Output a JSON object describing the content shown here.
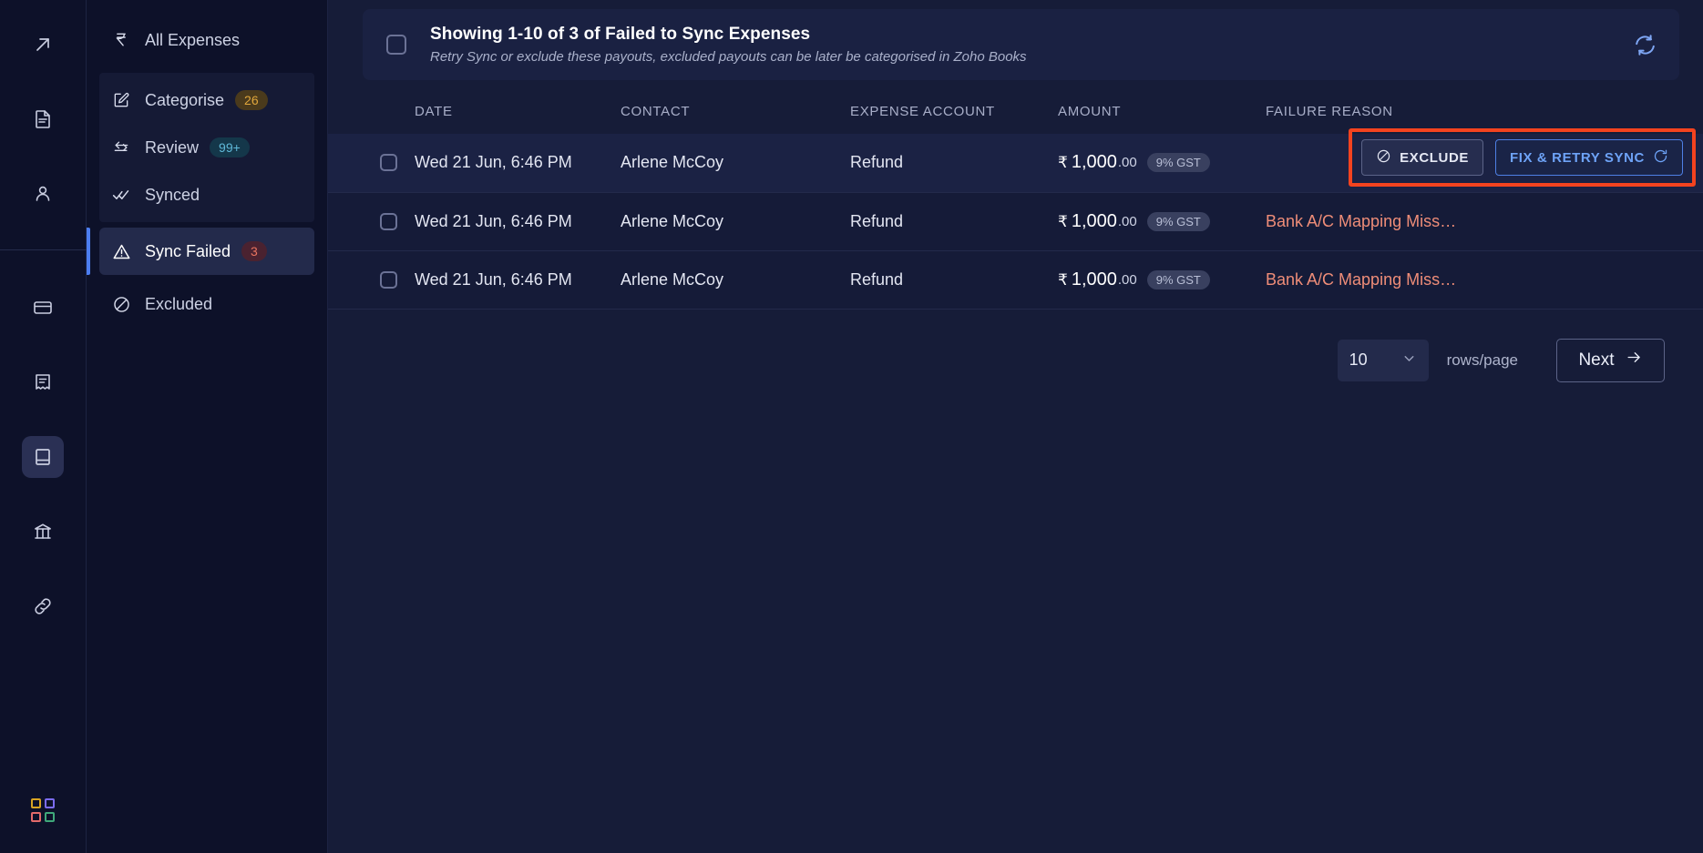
{
  "rail": {
    "icons": [
      {
        "name": "arrow-up-right-icon",
        "active": false
      },
      {
        "name": "document-icon",
        "active": false
      },
      {
        "name": "person-icon",
        "active": false
      },
      {
        "name": "card-icon",
        "active": false
      },
      {
        "name": "receipt-icon",
        "active": false
      },
      {
        "name": "book-icon",
        "active": true
      },
      {
        "name": "bank-icon",
        "active": false
      },
      {
        "name": "link-icon",
        "active": false
      }
    ],
    "logo_name": "grid-logo",
    "logo_colors": [
      "#d8a423",
      "#7b6cf0",
      "#e36a6a",
      "#3fa87a"
    ]
  },
  "sidebar": {
    "all_expenses": {
      "label": "All Expenses",
      "icon": "rupee-icon"
    },
    "group": [
      {
        "label": "Categorise",
        "icon": "edit-square-icon",
        "badge": "26",
        "badge_style": "amber"
      },
      {
        "label": "Review",
        "icon": "arrows-swap-icon",
        "badge": "99+",
        "badge_style": "teal"
      },
      {
        "label": "Synced",
        "icon": "double-check-icon",
        "badge": "",
        "badge_style": ""
      }
    ],
    "sync_failed": {
      "label": "Sync Failed",
      "icon": "warning-triangle-icon",
      "badge": "3",
      "badge_style": "red"
    },
    "excluded": {
      "label": "Excluded",
      "icon": "ban-icon"
    }
  },
  "header": {
    "title": "Showing 1-10 of 3 of Failed to Sync Expenses",
    "subtitle": "Retry Sync or exclude these payouts, excluded payouts can be later be categorised in Zoho Books",
    "refresh_icon": "refresh-icon"
  },
  "table": {
    "columns": [
      "DATE",
      "CONTACT",
      "EXPENSE ACCOUNT",
      "AMOUNT",
      "FAILURE REASON"
    ],
    "rows": [
      {
        "date": "Wed 21 Jun, 6:46 PM",
        "contact": "Arlene McCoy",
        "account": "Refund",
        "currency": "₹",
        "amount": "1,000",
        "decimals": ".00",
        "gst": "9% GST",
        "failure": "",
        "hovered": true
      },
      {
        "date": "Wed 21 Jun, 6:46 PM",
        "contact": "Arlene McCoy",
        "account": "Refund",
        "currency": "₹",
        "amount": "1,000",
        "decimals": ".00",
        "gst": "9% GST",
        "failure": "Bank A/C Mapping Miss…",
        "hovered": false
      },
      {
        "date": "Wed 21 Jun, 6:46 PM",
        "contact": "Arlene McCoy",
        "account": "Refund",
        "currency": "₹",
        "amount": "1,000",
        "decimals": ".00",
        "gst": "9% GST",
        "failure": "Bank A/C Mapping Miss…",
        "hovered": false
      }
    ]
  },
  "row_actions": {
    "exclude_label": "EXCLUDE",
    "exclude_icon": "ban-icon",
    "retry_label": "FIX & RETRY SYNC",
    "retry_icon": "refresh-icon",
    "highlight_color": "#f4431f"
  },
  "pagination": {
    "rows_per_page": "10",
    "rows_label": "rows/page",
    "next_label": "Next",
    "next_icon": "arrow-right-icon",
    "chevron_icon": "chevron-down-icon"
  }
}
